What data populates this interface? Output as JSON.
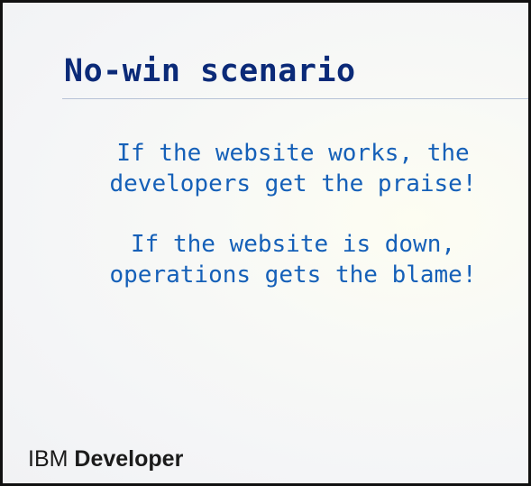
{
  "slide": {
    "title": "No-win scenario",
    "paragraphs": [
      {
        "lines": [
          "If the website works, the",
          "developers get the praise!"
        ]
      },
      {
        "lines": [
          "If the website is down,",
          "operations gets the blame!"
        ]
      }
    ]
  },
  "footer": {
    "brand": "IBM",
    "product": "Developer"
  },
  "colors": {
    "title": "#0b2a78",
    "body": "#1560b8",
    "background": "#f4f5f7",
    "frame": "#111111"
  }
}
